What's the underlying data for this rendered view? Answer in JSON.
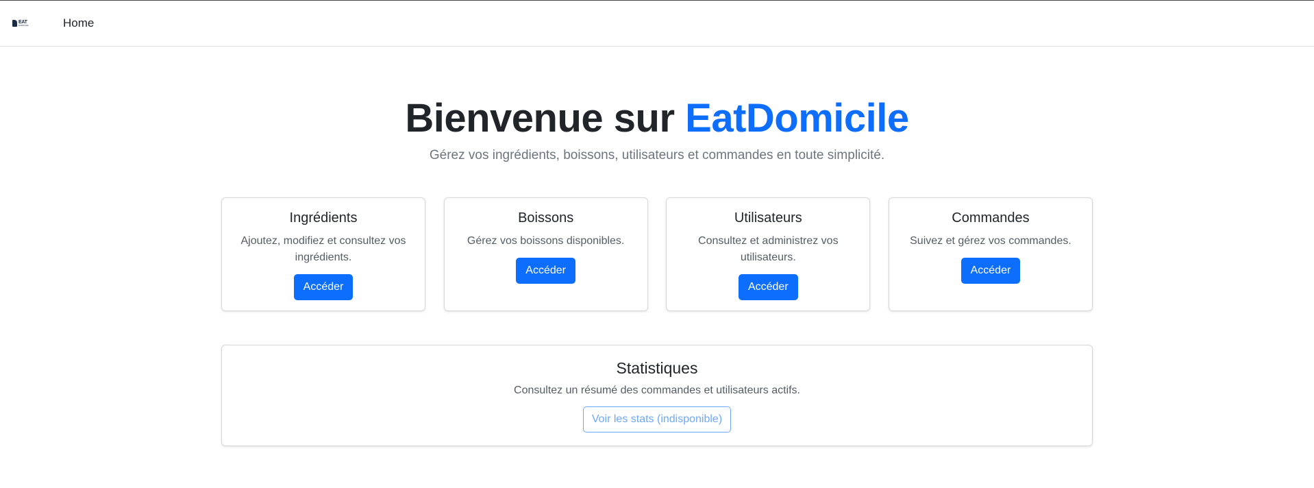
{
  "navbar": {
    "logo_text": "EAT",
    "logo_subtext": "DOMICILE",
    "home_link": "Home"
  },
  "hero": {
    "title_prefix": "Bienvenue sur ",
    "title_brand": "EatDomicile",
    "subtitle": "Gérez vos ingrédients, boissons, utilisateurs et commandes en toute simplicité."
  },
  "cards": [
    {
      "title": "Ingrédients",
      "description": "Ajoutez, modifiez et consultez vos ingrédients.",
      "button": "Accéder"
    },
    {
      "title": "Boissons",
      "description": "Gérez vos boissons disponibles.",
      "button": "Accéder"
    },
    {
      "title": "Utilisateurs",
      "description": "Consultez et administrez vos utilisateurs.",
      "button": "Accéder"
    },
    {
      "title": "Commandes",
      "description": "Suivez et gérez vos commandes.",
      "button": "Accéder"
    }
  ],
  "stats": {
    "title": "Statistiques",
    "description": "Consultez un résumé des commandes et utilisateurs actifs.",
    "button": "Voir les stats (indisponible)"
  },
  "colors": {
    "primary": "#0d6efd",
    "disabled_outline": "#6ea8fe"
  }
}
